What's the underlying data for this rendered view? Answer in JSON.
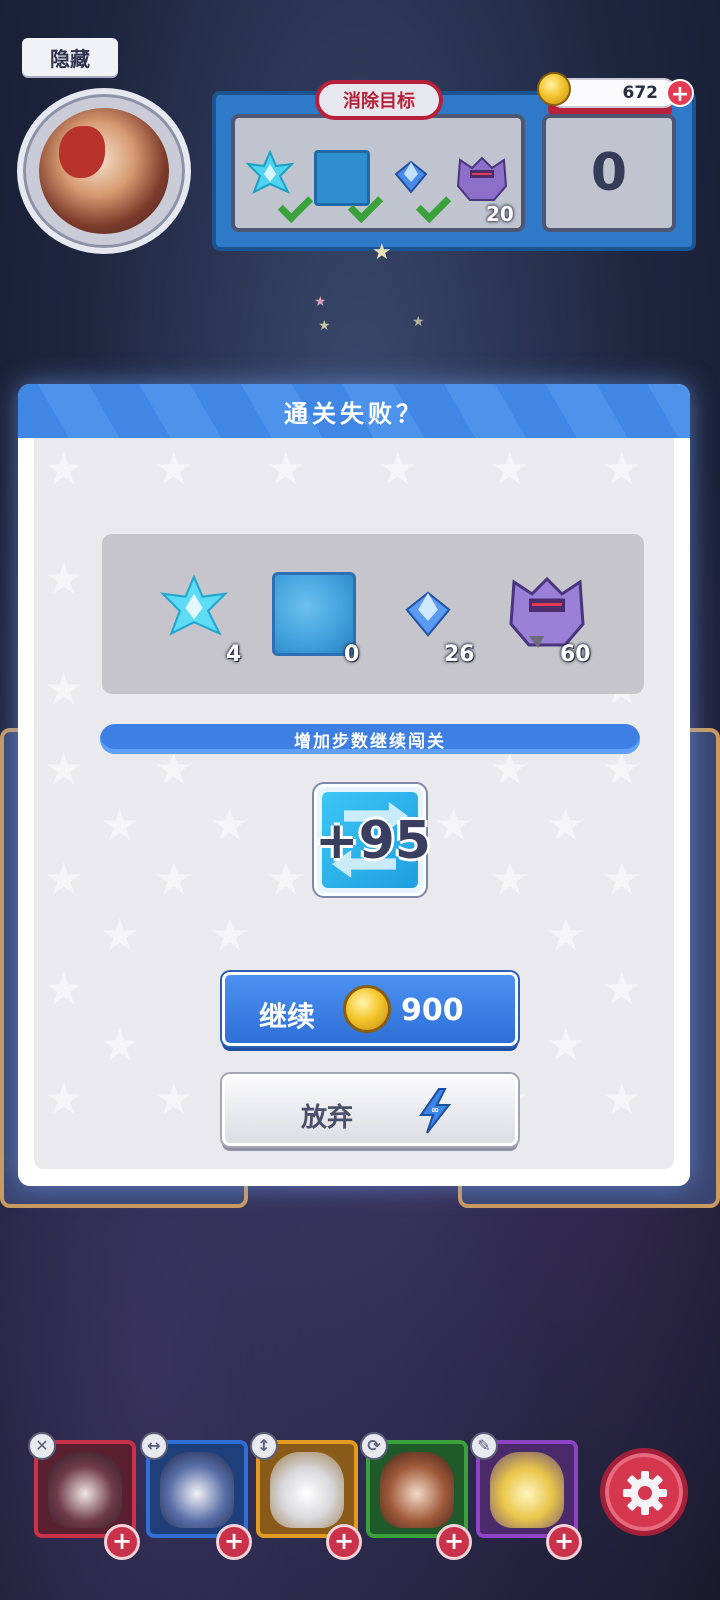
{
  "hud": {
    "hide_label": "隐藏",
    "goal_title": "消除目标",
    "goal_remaining": "20",
    "steps_value": "0",
    "coins": "672",
    "coins_plus": "+"
  },
  "modal": {
    "title": "通关失败？",
    "items": [
      {
        "icon": "cyan-crystal-star-icon",
        "count": "4"
      },
      {
        "icon": "ice-block-icon",
        "count": "0"
      },
      {
        "icon": "blue-gem-icon",
        "count": "26"
      },
      {
        "icon": "purple-bat-icon",
        "count": "60"
      }
    ],
    "ribbon_text": "增加步数继续闯关",
    "bonus_moves": "+95",
    "continue_label": "继续",
    "continue_cost": "900",
    "giveup_label": "放弃"
  },
  "heroes": [
    {
      "name": "hero-1",
      "color": "#c9324a"
    },
    {
      "name": "hero-2",
      "color": "#2f6fd6"
    },
    {
      "name": "hero-3",
      "color": "#e39a21"
    },
    {
      "name": "hero-4",
      "color": "#3aa13b"
    },
    {
      "name": "hero-5",
      "color": "#8e44c4"
    }
  ],
  "colors": {
    "accent_blue": "#3d7fe2",
    "goal_red": "#b8213b",
    "coin_gold": "#f3c531"
  }
}
